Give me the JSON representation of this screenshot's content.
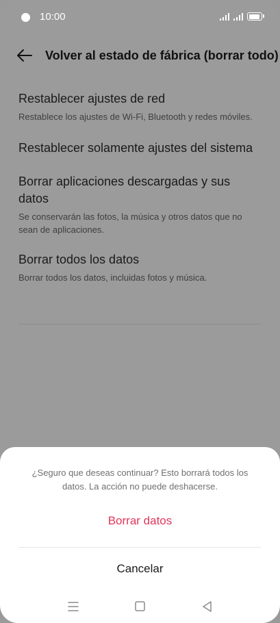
{
  "status_bar": {
    "time": "10:00"
  },
  "header": {
    "title": "Volver al estado de fábrica (borrar todo)",
    "back_icon": "arrow-left-icon"
  },
  "options": [
    {
      "title": "Restablecer ajustes de red",
      "description": "Restablece los ajustes de Wi-Fi, Bluetooth y redes móviles."
    },
    {
      "title": "Restablecer solamente ajustes del sistema",
      "description": ""
    },
    {
      "title": "Borrar aplicaciones descargadas y sus datos",
      "description": "Se conservarán las fotos, la música y otros datos que no sean de aplicaciones."
    },
    {
      "title": "Borrar todos los datos",
      "description": "Borrar todos los datos, incluidas fotos y música."
    }
  ],
  "dialog": {
    "message": "¿Seguro que deseas continuar? Esto borrará todos los datos. La acción no puede deshacerse.",
    "confirm_label": "Borrar datos",
    "cancel_label": "Cancelar"
  },
  "colors": {
    "accent": "#e0365c",
    "scrim": "#9b9b9b",
    "sheet": "#ffffff"
  },
  "nav_icons": [
    "menu-icon",
    "home-square-icon",
    "back-triangle-icon"
  ]
}
